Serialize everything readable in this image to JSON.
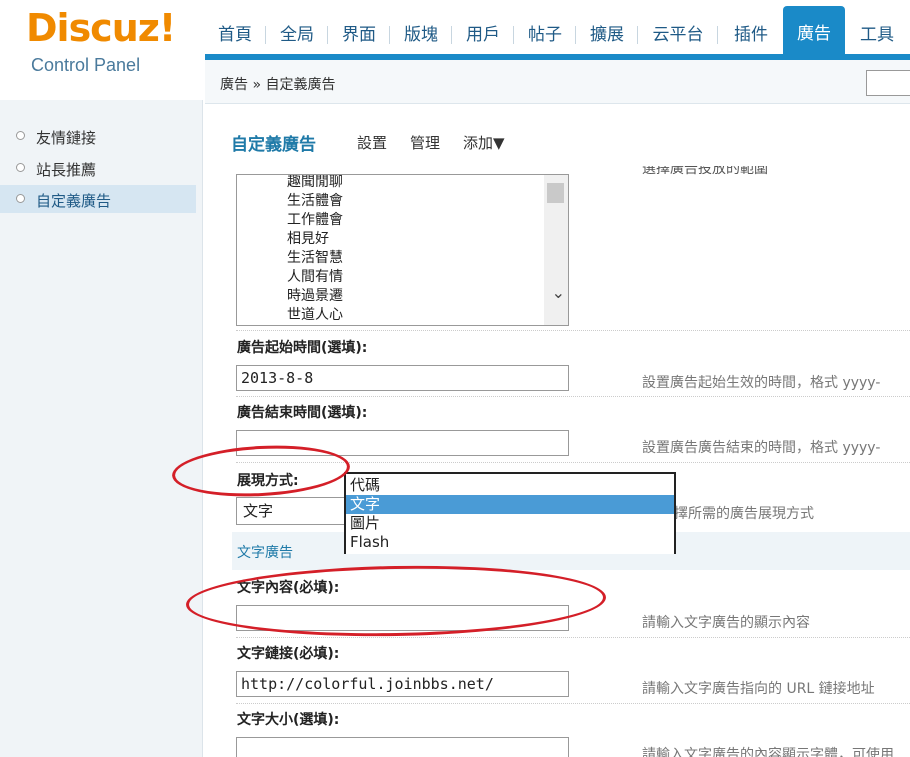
{
  "header": {
    "logo": "Discuz!",
    "logo_sub": "Control Panel",
    "nav": [
      "首頁",
      "全局",
      "界面",
      "版塊",
      "用戶",
      "帖子",
      "擴展",
      "云平台",
      "插件",
      "廣告",
      "工具"
    ],
    "active_nav": "廣告",
    "breadcrumb": "廣告 » 自定義廣告"
  },
  "sidebar": {
    "items": [
      "友情鏈接",
      "站長推薦",
      "自定義廣告"
    ],
    "active": "自定義廣告"
  },
  "subnav": {
    "title": "自定義廣告",
    "links": [
      "設置",
      "管理",
      "添加▼"
    ]
  },
  "forum_list": {
    "options": [
      "趣聞閒聊",
      "生活體會",
      "工作體會",
      "相見好",
      "生活智慧",
      "人間有情",
      "時過景遷",
      "世道人心"
    ],
    "cut_hint": "選擇廣告投放的範圍"
  },
  "form": {
    "start_time": {
      "label": "廣告起始時間(選填):",
      "value": "2013-8-8",
      "hint": "設置廣告起始生效的時間，格式 yyyy-"
    },
    "end_time": {
      "label": "廣告結束時間(選填):",
      "value": "",
      "hint": "設置廣告廣告結束的時間，格式 yyyy-"
    },
    "display_mode": {
      "label": "展現方式:",
      "value": "文字",
      "hint": "擇所需的廣告展現方式",
      "options": [
        "代碼",
        "文字",
        "圖片",
        "Flash"
      ],
      "selected": "文字"
    },
    "section_title": "文字廣告",
    "text_content": {
      "label": "文字內容(必填):",
      "value": "",
      "hint": "請輸入文字廣告的顯示內容"
    },
    "text_link": {
      "label": "文字鏈接(必填):",
      "value": "http://colorful.joinbbs.net/",
      "hint": "請輸入文字廣告指向的 URL 鏈接地址"
    },
    "text_size": {
      "label": "文字大小(選填):",
      "value": "",
      "hint": "請輸入文字廣告的內容顯示字體，可使用"
    }
  },
  "colors": {
    "brand_orange": "#f08a00",
    "accent_blue": "#1a8ac8",
    "annotation_red": "#d41f28",
    "selected_option": "#4a9bd6"
  }
}
